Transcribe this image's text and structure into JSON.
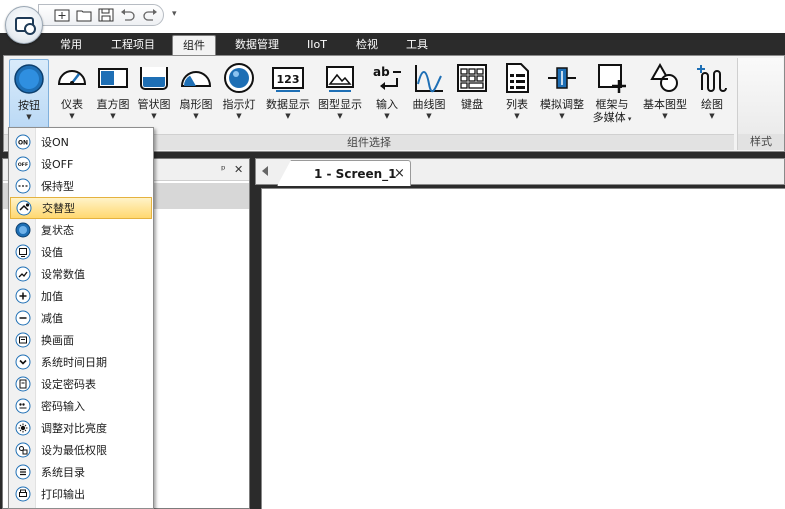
{
  "ribbon": {
    "tabs": [
      "常用",
      "工程项目",
      "组件",
      "数据管理",
      "IIoT",
      "检视",
      "工具"
    ],
    "active_tab": "组件",
    "buttons": [
      {
        "label": "按钮",
        "icon": "button-icon",
        "has_dropdown": true,
        "pressed": true
      },
      {
        "label": "仪表",
        "icon": "gauge-icon",
        "has_dropdown": true
      },
      {
        "label": "直方图",
        "icon": "bar-graph-icon",
        "has_dropdown": true
      },
      {
        "label": "管状图",
        "icon": "pipe-icon",
        "has_dropdown": true
      },
      {
        "label": "扇形图",
        "icon": "sector-icon",
        "has_dropdown": true
      },
      {
        "label": "指示灯",
        "icon": "indicator-lamp-icon",
        "has_dropdown": true
      },
      {
        "label": "数据显示",
        "icon": "numeric-display-icon",
        "has_dropdown": true
      },
      {
        "label": "图型显示",
        "icon": "picture-display-icon",
        "has_dropdown": true
      },
      {
        "label": "输入",
        "icon": "input-icon",
        "has_dropdown": true
      },
      {
        "label": "曲线图",
        "icon": "trend-chart-icon",
        "has_dropdown": true
      },
      {
        "label": "键盘",
        "icon": "keyboard-icon",
        "has_dropdown": false
      },
      {
        "label": "列表",
        "icon": "list-icon",
        "has_dropdown": true
      },
      {
        "label": "模拟调整",
        "icon": "slider-icon",
        "has_dropdown": true
      },
      {
        "label": "框架与",
        "label2": "多媒体",
        "icon": "frame-media-icon",
        "has_dropdown": true
      },
      {
        "label": "基本图型",
        "icon": "basic-shape-icon",
        "has_dropdown": true
      },
      {
        "label": "绘图",
        "icon": "drawing-icon",
        "has_dropdown": true
      }
    ],
    "group_label": "组件选择",
    "style_group_label": "样式"
  },
  "quick_access": {
    "dropdown_glyph": "▾"
  },
  "panel": {
    "pin_glyph": "ᵖ",
    "close_glyph": "✕"
  },
  "document": {
    "tab_label": "1 - Screen_1",
    "close_glyph": "×"
  },
  "button_menu": {
    "highlighted": "交替型",
    "items": [
      {
        "label": "设ON",
        "icon": "set-on-icon"
      },
      {
        "label": "设OFF",
        "icon": "set-off-icon"
      },
      {
        "label": "保持型",
        "icon": "momentary-icon"
      },
      {
        "label": "交替型",
        "icon": "toggle-icon"
      },
      {
        "label": "复状态",
        "icon": "multi-state-icon"
      },
      {
        "label": "设值",
        "icon": "set-value-icon"
      },
      {
        "label": "设常数值",
        "icon": "set-constant-icon"
      },
      {
        "label": "加值",
        "icon": "increment-icon"
      },
      {
        "label": "减值",
        "icon": "decrement-icon"
      },
      {
        "label": "换画面",
        "icon": "change-screen-icon"
      },
      {
        "label": "系统时间日期",
        "icon": "system-time-icon"
      },
      {
        "label": "设定密码表",
        "icon": "password-table-icon"
      },
      {
        "label": "密码输入",
        "icon": "password-input-icon"
      },
      {
        "label": "调整对比亮度",
        "icon": "brightness-icon"
      },
      {
        "label": "设为最低权限",
        "icon": "lowest-privilege-icon"
      },
      {
        "label": "系统目录",
        "icon": "system-directory-icon"
      },
      {
        "label": "打印输出",
        "icon": "print-icon"
      }
    ]
  },
  "colors": {
    "dark_chrome": "#2b2b2b",
    "ribbon_bg": "#f3f3f3",
    "pressed_blue": "#b9d8f5",
    "menu_highlight": "#ffd870",
    "icon_blue": "#1e6fb5"
  }
}
